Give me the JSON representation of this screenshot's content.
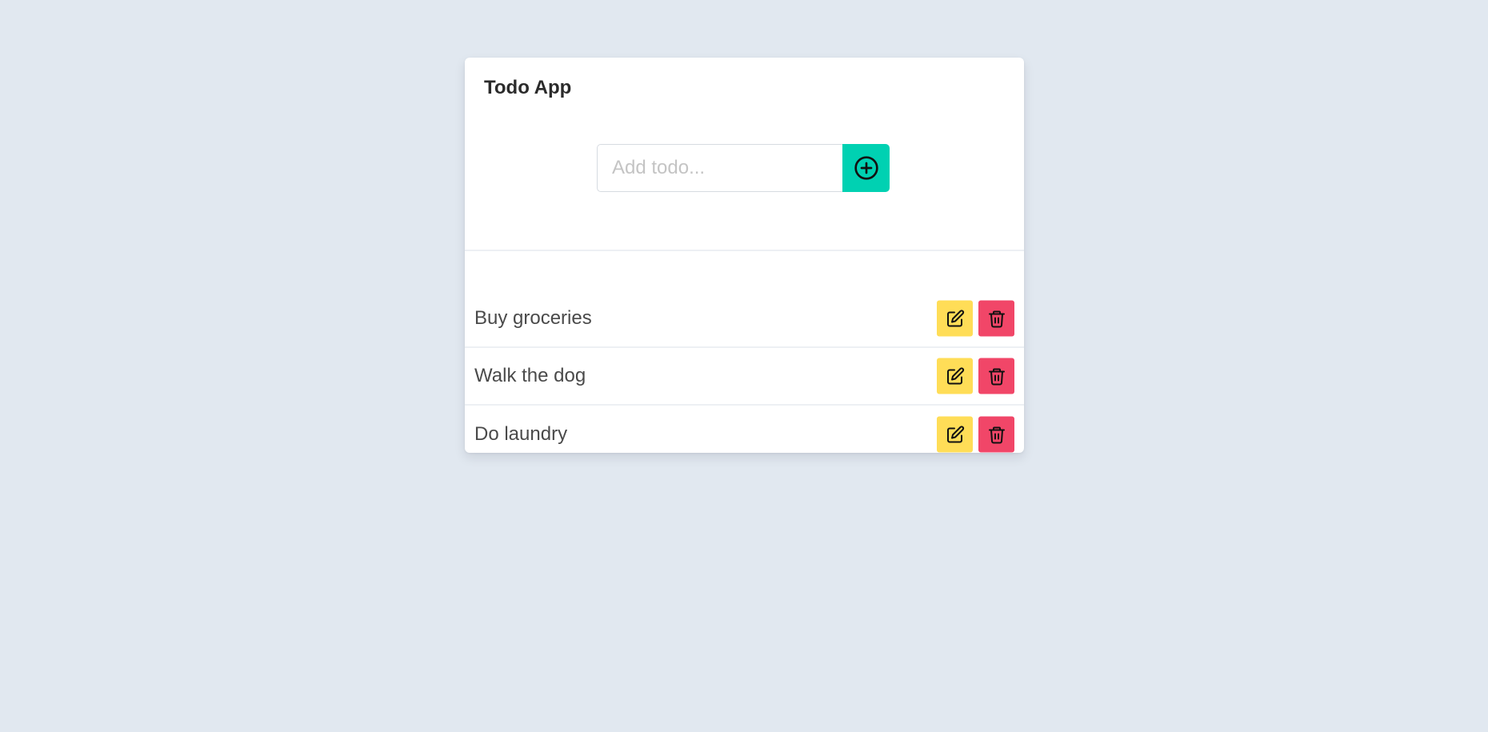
{
  "app": {
    "title": "Todo App"
  },
  "add_form": {
    "placeholder": "Add todo...",
    "value": "",
    "button_icon": "plus-circle-icon",
    "button_color": "#00d1b2"
  },
  "todos": [
    {
      "text": "Buy groceries"
    },
    {
      "text": "Walk the dog"
    },
    {
      "text": "Do laundry"
    }
  ],
  "item_actions": {
    "edit_icon": "edit-icon",
    "edit_color": "#ffdd57",
    "delete_icon": "trash-icon",
    "delete_color": "#f14668"
  },
  "colors": {
    "background": "#e1e8f0",
    "card": "#ffffff",
    "text": "#4a4a4a"
  }
}
